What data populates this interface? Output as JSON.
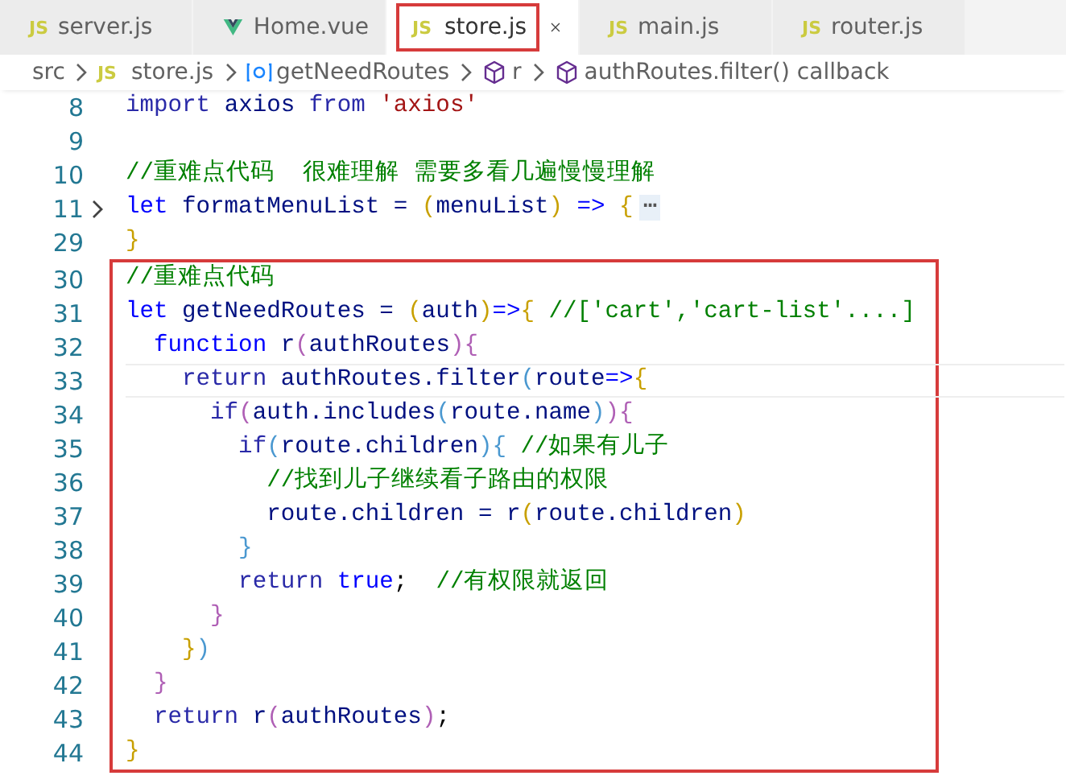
{
  "tabs": [
    {
      "label": "server.js",
      "kind": "js",
      "badge": "JS",
      "selected": false,
      "highlighted": false
    },
    {
      "label": "Home.vue",
      "kind": "vue",
      "selected": false,
      "highlighted": false
    },
    {
      "label": "store.js",
      "kind": "js",
      "badge": "JS",
      "selected": true,
      "highlighted": true
    },
    {
      "label": "main.js",
      "kind": "js",
      "badge": "JS",
      "selected": false,
      "highlighted": false
    },
    {
      "label": "router.js",
      "kind": "js",
      "badge": "JS",
      "selected": false,
      "highlighted": false
    }
  ],
  "breadcrumb": [
    {
      "label": "src"
    },
    {
      "label": "store.js",
      "kind": "js",
      "badge": "JS"
    },
    {
      "label": "getNeedRoutes",
      "kind": "variable"
    },
    {
      "label": "r",
      "kind": "method"
    },
    {
      "label": "authRoutes.filter() callback",
      "kind": "method"
    }
  ],
  "sections": [
    {
      "highlighted": false,
      "lines": [
        {
          "n": "8",
          "current": false,
          "folded": false,
          "tokens": [
            {
              "kind": "ctl",
              "t": "import "
            },
            {
              "kind": "id",
              "t": "axios "
            },
            {
              "kind": "ctl",
              "t": "from "
            },
            {
              "kind": "str",
              "t": "'axios'"
            }
          ]
        },
        {
          "n": "9",
          "current": false,
          "folded": false
        },
        {
          "n": "10",
          "current": false,
          "folded": false,
          "tokens": [
            {
              "kind": "com",
              "t": "//重难点代码  很难理解 需要多看几遍慢慢理解"
            }
          ]
        },
        {
          "n": "11",
          "current": false,
          "folded": true,
          "tokens": [
            {
              "kind": "kw",
              "t": "let "
            },
            {
              "kind": "id",
              "t": "formatMenuList = "
            },
            {
              "kind": "b1",
              "t": "("
            },
            {
              "kind": "id",
              "t": "menuList"
            },
            {
              "kind": "b1",
              "t": ") "
            },
            {
              "kind": "kw",
              "t": "=> "
            },
            {
              "kind": "b1",
              "t": "{"
            },
            {
              "kind": "fold",
              "t": "⋯"
            }
          ]
        },
        {
          "n": "29",
          "current": false,
          "folded": false,
          "tokens": [
            {
              "kind": "b1",
              "t": "}"
            }
          ]
        }
      ]
    },
    {
      "highlighted": true,
      "lines": [
        {
          "n": "30",
          "current": false,
          "folded": false,
          "tokens": [
            {
              "kind": "com",
              "t": "//重难点代码"
            }
          ]
        },
        {
          "n": "31",
          "current": false,
          "folded": false,
          "tokens": [
            {
              "kind": "kw",
              "t": "let "
            },
            {
              "kind": "id",
              "t": "getNeedRoutes = "
            },
            {
              "kind": "b1",
              "t": "("
            },
            {
              "kind": "id",
              "t": "auth"
            },
            {
              "kind": "b1",
              "t": ")"
            },
            {
              "kind": "kw",
              "t": "=>"
            },
            {
              "kind": "b1",
              "t": "{ "
            },
            {
              "kind": "com",
              "t": "//['cart','cart-list'....]"
            }
          ]
        },
        {
          "n": "32",
          "current": false,
          "folded": false,
          "tokens": [
            {
              "kind": "kw",
              "t": "  function "
            },
            {
              "kind": "id",
              "t": "r"
            },
            {
              "kind": "b2",
              "t": "("
            },
            {
              "kind": "id",
              "t": "authRoutes"
            },
            {
              "kind": "b2",
              "t": "){"
            }
          ]
        },
        {
          "n": "33",
          "current": true,
          "folded": false,
          "tokens": [
            {
              "kind": "ctl",
              "t": "    return "
            },
            {
              "kind": "id",
              "t": "authRoutes.filter"
            },
            {
              "kind": "b3",
              "t": "("
            },
            {
              "kind": "id",
              "t": "route"
            },
            {
              "kind": "kw",
              "t": "=>"
            },
            {
              "kind": "b1",
              "t": "{"
            }
          ]
        },
        {
          "n": "34",
          "current": false,
          "folded": false,
          "tokens": [
            {
              "kind": "ctl",
              "t": "      if"
            },
            {
              "kind": "b2",
              "t": "("
            },
            {
              "kind": "id",
              "t": "auth.includes"
            },
            {
              "kind": "b3",
              "t": "("
            },
            {
              "kind": "id",
              "t": "route.name"
            },
            {
              "kind": "b3",
              "t": ")"
            },
            {
              "kind": "b2",
              "t": "){"
            }
          ]
        },
        {
          "n": "35",
          "current": false,
          "folded": false,
          "tokens": [
            {
              "kind": "ctl",
              "t": "        if"
            },
            {
              "kind": "b3",
              "t": "("
            },
            {
              "kind": "id",
              "t": "route.children"
            },
            {
              "kind": "b3",
              "t": "){ "
            },
            {
              "kind": "com",
              "t": "//如果有儿子"
            }
          ]
        },
        {
          "n": "36",
          "current": false,
          "folded": false,
          "tokens": [
            {
              "kind": "com",
              "t": "          //找到儿子继续看子路由的权限"
            }
          ]
        },
        {
          "n": "37",
          "current": false,
          "folded": false,
          "tokens": [
            {
              "kind": "id",
              "t": "          route.children = r"
            },
            {
              "kind": "b1",
              "t": "("
            },
            {
              "kind": "id",
              "t": "route.children"
            },
            {
              "kind": "b1",
              "t": ")"
            }
          ]
        },
        {
          "n": "38",
          "current": false,
          "folded": false,
          "tokens": [
            {
              "kind": "b3",
              "t": "        }"
            }
          ]
        },
        {
          "n": "39",
          "current": false,
          "folded": false,
          "tokens": [
            {
              "kind": "ctl",
              "t": "        return "
            },
            {
              "kind": "kw",
              "t": "true"
            },
            {
              "kind": "p",
              "t": ";  "
            },
            {
              "kind": "com",
              "t": "//有权限就返回"
            }
          ]
        },
        {
          "n": "40",
          "current": false,
          "folded": false,
          "tokens": [
            {
              "kind": "b2",
              "t": "      }"
            }
          ]
        },
        {
          "n": "41",
          "current": false,
          "folded": false,
          "tokens": [
            {
              "kind": "b1",
              "t": "    }"
            },
            {
              "kind": "b3",
              "t": ")"
            }
          ]
        },
        {
          "n": "42",
          "current": false,
          "folded": false,
          "tokens": [
            {
              "kind": "b2",
              "t": "  }"
            }
          ]
        },
        {
          "n": "43",
          "current": false,
          "folded": false,
          "tokens": [
            {
              "kind": "ctl",
              "t": "  return "
            },
            {
              "kind": "id",
              "t": "r"
            },
            {
              "kind": "b2",
              "t": "("
            },
            {
              "kind": "id",
              "t": "authRoutes"
            },
            {
              "kind": "b2",
              "t": ")"
            },
            {
              "kind": "p",
              "t": ";"
            }
          ]
        },
        {
          "n": "44",
          "current": false,
          "folded": false,
          "tokens": [
            {
              "kind": "b1",
              "t": "}"
            }
          ]
        }
      ]
    }
  ]
}
